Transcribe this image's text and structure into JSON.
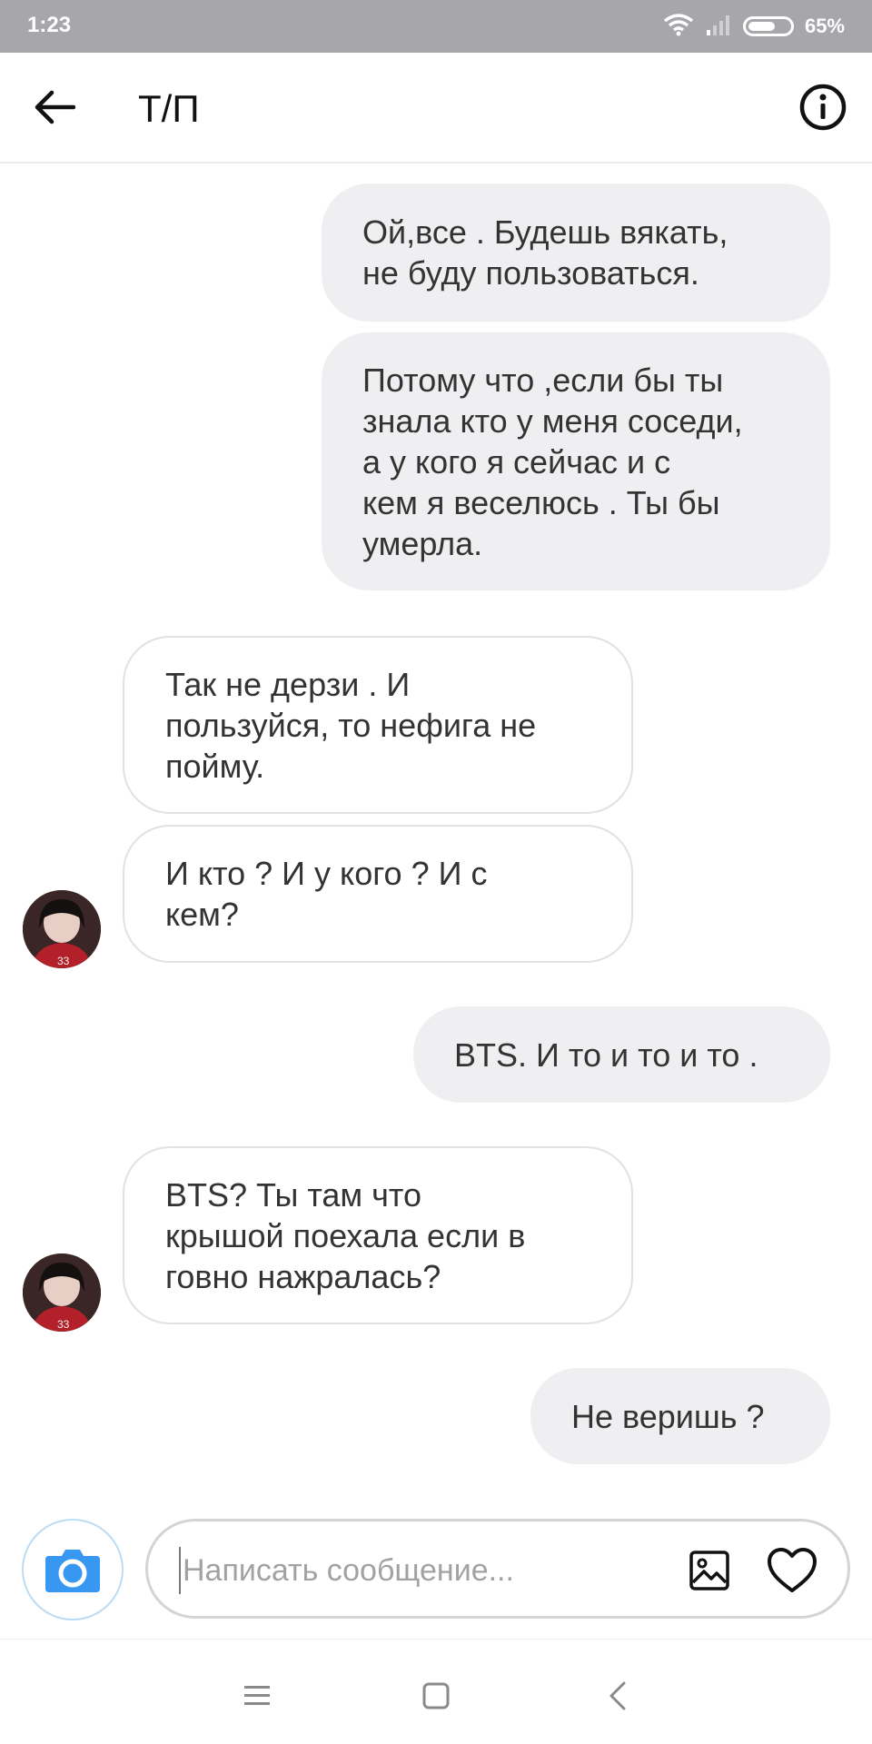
{
  "status_bar": {
    "time": "1:23",
    "battery_percent": "65%",
    "battery_level": 0.65,
    "icons": [
      "wifi-icon",
      "signal-icon",
      "battery-icon"
    ]
  },
  "header": {
    "title": "Т/П",
    "back_icon": "arrow-left-icon",
    "info_icon": "info-circle-icon"
  },
  "messages": [
    {
      "direction": "out",
      "text": "Ой,все . Будешь вякать,\nне буду пользоваться."
    },
    {
      "direction": "out",
      "text": "Потому что ,если бы ты\nзнала кто у меня соседи,\nа у кого я сейчас и с\nкем я  веселюсь . Ты бы\nумерла."
    },
    {
      "direction": "in",
      "text": "Так не дерзи . И\nпользуйся, то нефига не\nпойму."
    },
    {
      "direction": "in",
      "text": "И кто ? И у кого ? И с\nкем?"
    },
    {
      "direction": "out",
      "text": "BTS. И то и то и то ."
    },
    {
      "direction": "in",
      "text": "BTS?  Ты там что\nкрышой поехала если в\nговно нажралась?"
    },
    {
      "direction": "out",
      "text": "Не веришь ?"
    }
  ],
  "composer": {
    "placeholder": "Написать сообщение...",
    "camera_icon": "camera-icon",
    "gallery_icon": "image-icon",
    "like_icon": "heart-icon"
  },
  "nav_bar": {
    "icons": [
      "menu-icon",
      "home-square-icon",
      "back-chevron-icon"
    ]
  },
  "colors": {
    "status_bar_bg": "#a7a6ab",
    "outgoing_bubble": "#efeff1",
    "incoming_border": "#e1e1e1",
    "camera_blue": "#3897f0"
  }
}
